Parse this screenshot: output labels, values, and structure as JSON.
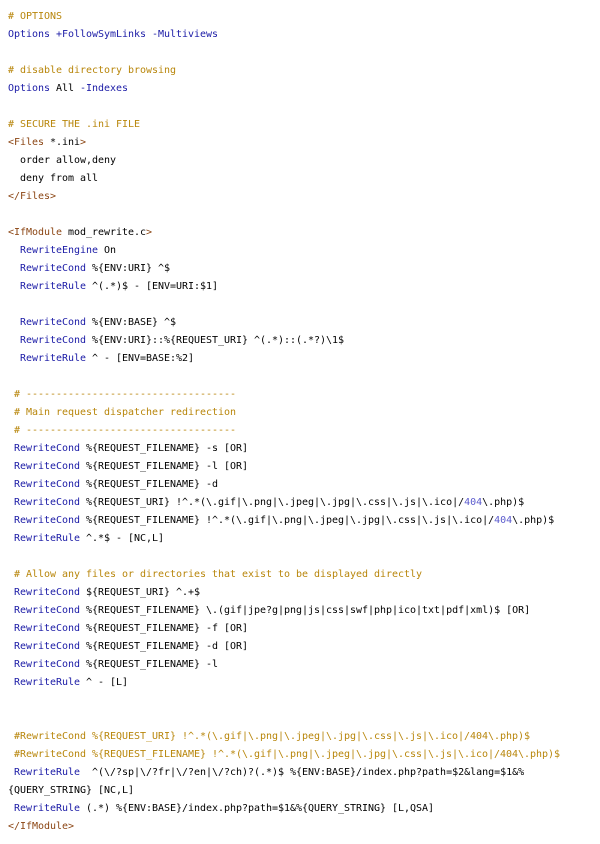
{
  "colors": {
    "comment": "#b8860b",
    "keyword": "#1a1aa6",
    "tag": "#8b4513",
    "text": "#000000",
    "background": "#ffffff"
  },
  "lines": [
    [
      [
        "comment",
        "# OPTIONS"
      ]
    ],
    [
      [
        "keyword",
        "Options"
      ],
      [
        "plain",
        " "
      ],
      [
        "keyword",
        "+FollowSymLinks -Multiviews"
      ]
    ],
    [],
    [
      [
        "comment",
        "# disable directory browsing"
      ]
    ],
    [
      [
        "keyword",
        "Options"
      ],
      [
        "plain",
        " All "
      ],
      [
        "keyword",
        "-Indexes"
      ]
    ],
    [],
    [
      [
        "comment",
        "# SECURE THE .ini FILE"
      ]
    ],
    [
      [
        "tag",
        "<Files"
      ],
      [
        "plain",
        " *.ini"
      ],
      [
        "tag",
        ">"
      ]
    ],
    [
      [
        "plain",
        "  order allow,deny"
      ]
    ],
    [
      [
        "plain",
        "  deny from all"
      ]
    ],
    [
      [
        "tag",
        "</Files>"
      ]
    ],
    [],
    [
      [
        "tag",
        "<IfModule"
      ],
      [
        "plain",
        " mod_rewrite.c"
      ],
      [
        "tag",
        ">"
      ]
    ],
    [
      [
        "plain",
        "  "
      ],
      [
        "keyword",
        "RewriteEngine"
      ],
      [
        "plain",
        " On"
      ]
    ],
    [
      [
        "plain",
        "  "
      ],
      [
        "keyword",
        "RewriteCond"
      ],
      [
        "plain",
        " %{ENV:URI} ^$"
      ]
    ],
    [
      [
        "plain",
        "  "
      ],
      [
        "keyword",
        "RewriteRule"
      ],
      [
        "plain",
        " ^(.*)$ - [ENV=URI:$1]"
      ]
    ],
    [],
    [
      [
        "plain",
        "  "
      ],
      [
        "keyword",
        "RewriteCond"
      ],
      [
        "plain",
        " %{ENV:BASE} ^$"
      ]
    ],
    [
      [
        "plain",
        "  "
      ],
      [
        "keyword",
        "RewriteCond"
      ],
      [
        "plain",
        " %{ENV:URI}::%{REQUEST_URI} ^(.*)::(.*?)\\1$"
      ]
    ],
    [
      [
        "plain",
        "  "
      ],
      [
        "keyword",
        "RewriteRule"
      ],
      [
        "plain",
        " ^ - [ENV=BASE:%2]"
      ]
    ],
    [],
    [
      [
        "plain",
        " "
      ],
      [
        "comment",
        "# -----------------------------------"
      ]
    ],
    [
      [
        "plain",
        " "
      ],
      [
        "comment",
        "# Main request dispatcher redirection"
      ]
    ],
    [
      [
        "plain",
        " "
      ],
      [
        "comment",
        "# -----------------------------------"
      ]
    ],
    [
      [
        "plain",
        " "
      ],
      [
        "keyword",
        "RewriteCond"
      ],
      [
        "plain",
        " %{REQUEST_FILENAME} -s [OR]"
      ]
    ],
    [
      [
        "plain",
        " "
      ],
      [
        "keyword",
        "RewriteCond"
      ],
      [
        "plain",
        " %{REQUEST_FILENAME} -l [OR]"
      ]
    ],
    [
      [
        "plain",
        " "
      ],
      [
        "keyword",
        "RewriteCond"
      ],
      [
        "plain",
        " %{REQUEST_FILENAME} -d"
      ]
    ],
    [
      [
        "plain",
        " "
      ],
      [
        "keyword",
        "RewriteCond"
      ],
      [
        "plain",
        " %{REQUEST_URI} !^.*(\\.gif|\\.png|\\.jpeg|\\.jpg|\\.css|\\.js|\\.ico|/"
      ],
      [
        "num",
        "404"
      ],
      [
        "plain",
        "\\.php)$"
      ]
    ],
    [
      [
        "plain",
        " "
      ],
      [
        "keyword",
        "RewriteCond"
      ],
      [
        "plain",
        " %{REQUEST_FILENAME} !^.*(\\.gif|\\.png|\\.jpeg|\\.jpg|\\.css|\\.js|\\.ico|/"
      ],
      [
        "num",
        "404"
      ],
      [
        "plain",
        "\\.php)$"
      ]
    ],
    [
      [
        "plain",
        " "
      ],
      [
        "keyword",
        "RewriteRule"
      ],
      [
        "plain",
        " ^.*$ - [NC,L]"
      ]
    ],
    [],
    [
      [
        "plain",
        " "
      ],
      [
        "comment",
        "# Allow any files or directories that exist to be displayed directly"
      ]
    ],
    [
      [
        "plain",
        " "
      ],
      [
        "keyword",
        "RewriteCond"
      ],
      [
        "plain",
        " ${REQUEST_URI} ^.+$"
      ]
    ],
    [
      [
        "plain",
        " "
      ],
      [
        "keyword",
        "RewriteCond"
      ],
      [
        "plain",
        " %{REQUEST_FILENAME} \\.(gif|jpe?g|png|js|css|swf|php|ico|txt|pdf|xml)$ [OR]"
      ]
    ],
    [
      [
        "plain",
        " "
      ],
      [
        "keyword",
        "RewriteCond"
      ],
      [
        "plain",
        " %{REQUEST_FILENAME} -f [OR]"
      ]
    ],
    [
      [
        "plain",
        " "
      ],
      [
        "keyword",
        "RewriteCond"
      ],
      [
        "plain",
        " %{REQUEST_FILENAME} -d [OR]"
      ]
    ],
    [
      [
        "plain",
        " "
      ],
      [
        "keyword",
        "RewriteCond"
      ],
      [
        "plain",
        " %{REQUEST_FILENAME} -l"
      ]
    ],
    [
      [
        "plain",
        " "
      ],
      [
        "keyword",
        "RewriteRule"
      ],
      [
        "plain",
        " ^ - [L]"
      ]
    ],
    [],
    [],
    [
      [
        "plain",
        " "
      ],
      [
        "comment",
        "#RewriteCond %{REQUEST_URI} !^.*(\\.gif|\\.png|\\.jpeg|\\.jpg|\\.css|\\.js|\\.ico|/404\\.php)$"
      ]
    ],
    [
      [
        "plain",
        " "
      ],
      [
        "comment",
        "#RewriteCond %{REQUEST_FILENAME} !^.*(\\.gif|\\.png|\\.jpeg|\\.jpg|\\.css|\\.js|\\.ico|/404\\.php)$"
      ]
    ],
    [
      [
        "plain",
        " "
      ],
      [
        "keyword",
        "RewriteRule"
      ],
      [
        "plain",
        "  ^(\\/?sp|\\/?fr|\\/?en|\\/?ch)?(.*)$ %{ENV:BASE}/index.php?path=$2&lang=$1&%"
      ]
    ],
    [
      [
        "plain",
        "{QUERY_STRING} [NC,L]"
      ]
    ],
    [
      [
        "plain",
        " "
      ],
      [
        "keyword",
        "RewriteRule"
      ],
      [
        "plain",
        " (.*) %{ENV:BASE}/index.php?path=$1&%{QUERY_STRING} [L,QSA]"
      ]
    ],
    [
      [
        "tag",
        "</IfModule>"
      ]
    ]
  ]
}
